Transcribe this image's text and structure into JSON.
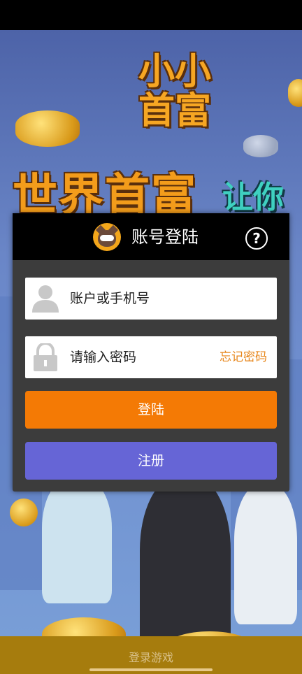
{
  "background": {
    "logo_small": "小小\n首富",
    "logo_big": "世界首富",
    "logo_tail": "让你"
  },
  "login_dialog": {
    "title": "账号登陆",
    "help_label": "?",
    "account_placeholder": "账户或手机号",
    "password_placeholder": "请输入密码",
    "forgot_password": "忘记密码",
    "login_button": "登陆",
    "register_button": "注册"
  },
  "bottom": {
    "label": "登录游戏"
  },
  "colors": {
    "login_button": "#f47a05",
    "register_button": "#6665d6",
    "forgot_link": "#e7861a",
    "bottom_bar": "#a67c0d"
  },
  "icons": {
    "account": "user-icon",
    "password": "lock-icon",
    "help": "question-circle-icon",
    "avatar": "raccoon-mascot-icon"
  }
}
